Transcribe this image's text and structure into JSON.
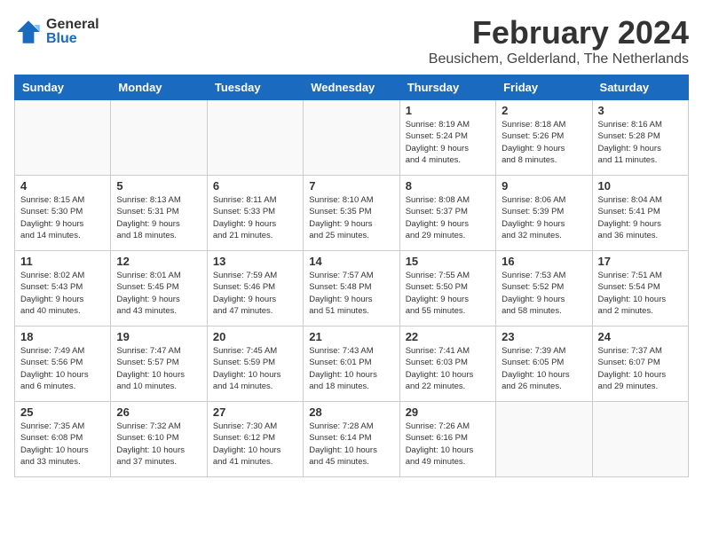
{
  "logo": {
    "general": "General",
    "blue": "Blue"
  },
  "title": {
    "month_year": "February 2024",
    "location": "Beusichem, Gelderland, The Netherlands"
  },
  "headers": [
    "Sunday",
    "Monday",
    "Tuesday",
    "Wednesday",
    "Thursday",
    "Friday",
    "Saturday"
  ],
  "weeks": [
    [
      {
        "day": "",
        "info": ""
      },
      {
        "day": "",
        "info": ""
      },
      {
        "day": "",
        "info": ""
      },
      {
        "day": "",
        "info": ""
      },
      {
        "day": "1",
        "info": "Sunrise: 8:19 AM\nSunset: 5:24 PM\nDaylight: 9 hours\nand 4 minutes."
      },
      {
        "day": "2",
        "info": "Sunrise: 8:18 AM\nSunset: 5:26 PM\nDaylight: 9 hours\nand 8 minutes."
      },
      {
        "day": "3",
        "info": "Sunrise: 8:16 AM\nSunset: 5:28 PM\nDaylight: 9 hours\nand 11 minutes."
      }
    ],
    [
      {
        "day": "4",
        "info": "Sunrise: 8:15 AM\nSunset: 5:30 PM\nDaylight: 9 hours\nand 14 minutes."
      },
      {
        "day": "5",
        "info": "Sunrise: 8:13 AM\nSunset: 5:31 PM\nDaylight: 9 hours\nand 18 minutes."
      },
      {
        "day": "6",
        "info": "Sunrise: 8:11 AM\nSunset: 5:33 PM\nDaylight: 9 hours\nand 21 minutes."
      },
      {
        "day": "7",
        "info": "Sunrise: 8:10 AM\nSunset: 5:35 PM\nDaylight: 9 hours\nand 25 minutes."
      },
      {
        "day": "8",
        "info": "Sunrise: 8:08 AM\nSunset: 5:37 PM\nDaylight: 9 hours\nand 29 minutes."
      },
      {
        "day": "9",
        "info": "Sunrise: 8:06 AM\nSunset: 5:39 PM\nDaylight: 9 hours\nand 32 minutes."
      },
      {
        "day": "10",
        "info": "Sunrise: 8:04 AM\nSunset: 5:41 PM\nDaylight: 9 hours\nand 36 minutes."
      }
    ],
    [
      {
        "day": "11",
        "info": "Sunrise: 8:02 AM\nSunset: 5:43 PM\nDaylight: 9 hours\nand 40 minutes."
      },
      {
        "day": "12",
        "info": "Sunrise: 8:01 AM\nSunset: 5:45 PM\nDaylight: 9 hours\nand 43 minutes."
      },
      {
        "day": "13",
        "info": "Sunrise: 7:59 AM\nSunset: 5:46 PM\nDaylight: 9 hours\nand 47 minutes."
      },
      {
        "day": "14",
        "info": "Sunrise: 7:57 AM\nSunset: 5:48 PM\nDaylight: 9 hours\nand 51 minutes."
      },
      {
        "day": "15",
        "info": "Sunrise: 7:55 AM\nSunset: 5:50 PM\nDaylight: 9 hours\nand 55 minutes."
      },
      {
        "day": "16",
        "info": "Sunrise: 7:53 AM\nSunset: 5:52 PM\nDaylight: 9 hours\nand 58 minutes."
      },
      {
        "day": "17",
        "info": "Sunrise: 7:51 AM\nSunset: 5:54 PM\nDaylight: 10 hours\nand 2 minutes."
      }
    ],
    [
      {
        "day": "18",
        "info": "Sunrise: 7:49 AM\nSunset: 5:56 PM\nDaylight: 10 hours\nand 6 minutes."
      },
      {
        "day": "19",
        "info": "Sunrise: 7:47 AM\nSunset: 5:57 PM\nDaylight: 10 hours\nand 10 minutes."
      },
      {
        "day": "20",
        "info": "Sunrise: 7:45 AM\nSunset: 5:59 PM\nDaylight: 10 hours\nand 14 minutes."
      },
      {
        "day": "21",
        "info": "Sunrise: 7:43 AM\nSunset: 6:01 PM\nDaylight: 10 hours\nand 18 minutes."
      },
      {
        "day": "22",
        "info": "Sunrise: 7:41 AM\nSunset: 6:03 PM\nDaylight: 10 hours\nand 22 minutes."
      },
      {
        "day": "23",
        "info": "Sunrise: 7:39 AM\nSunset: 6:05 PM\nDaylight: 10 hours\nand 26 minutes."
      },
      {
        "day": "24",
        "info": "Sunrise: 7:37 AM\nSunset: 6:07 PM\nDaylight: 10 hours\nand 29 minutes."
      }
    ],
    [
      {
        "day": "25",
        "info": "Sunrise: 7:35 AM\nSunset: 6:08 PM\nDaylight: 10 hours\nand 33 minutes."
      },
      {
        "day": "26",
        "info": "Sunrise: 7:32 AM\nSunset: 6:10 PM\nDaylight: 10 hours\nand 37 minutes."
      },
      {
        "day": "27",
        "info": "Sunrise: 7:30 AM\nSunset: 6:12 PM\nDaylight: 10 hours\nand 41 minutes."
      },
      {
        "day": "28",
        "info": "Sunrise: 7:28 AM\nSunset: 6:14 PM\nDaylight: 10 hours\nand 45 minutes."
      },
      {
        "day": "29",
        "info": "Sunrise: 7:26 AM\nSunset: 6:16 PM\nDaylight: 10 hours\nand 49 minutes."
      },
      {
        "day": "",
        "info": ""
      },
      {
        "day": "",
        "info": ""
      }
    ]
  ]
}
